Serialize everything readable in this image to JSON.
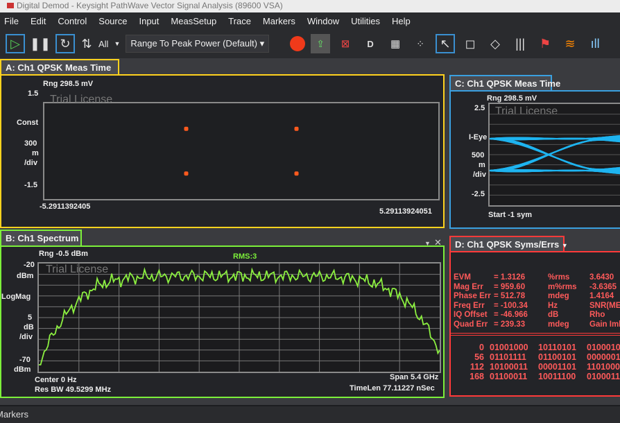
{
  "window": {
    "title": "Digital Demod - Keysight PathWave Vector Signal Analysis (89600 VSA)"
  },
  "menu": [
    "File",
    "Edit",
    "Control",
    "Source",
    "Input",
    "MeasSetup",
    "Trace",
    "Markers",
    "Window",
    "Utilities",
    "Help"
  ],
  "toolbar": {
    "all_label": "All",
    "range_mode": "Range To Peak Power (Default)"
  },
  "colors": {
    "trace_a": "#ffd21e",
    "trace_b": "#7cf03a",
    "trace_c": "#3aa0e0",
    "trace_d": "#ff3a3a",
    "spectrum": "#8cf040",
    "eye": "#1eb4f0",
    "const": "#ff5a1e"
  },
  "panel_a": {
    "tab": "A: Ch1 QPSK Meas Time",
    "range": "Rng 298.5 mV",
    "y_top": "1.5",
    "format": "Const",
    "scale": [
      "300",
      "m",
      "/div"
    ],
    "y_bottom": "-1.5",
    "x_left": "-5.2911392405",
    "x_right": "5.29113924051",
    "watermark": "Trial License",
    "points": [
      [
        -0.71,
        0.7
      ],
      [
        0.71,
        0.7
      ],
      [
        -0.71,
        -0.7
      ],
      [
        0.71,
        -0.7
      ]
    ],
    "ylim": [
      -1.5,
      1.5
    ]
  },
  "panel_c": {
    "tab": "C: Ch1 QPSK Meas Time",
    "range": "Rng 298.5 mV",
    "y_top": "2.5",
    "format": "I-Eye",
    "scale": [
      "500",
      "m",
      "/div"
    ],
    "y_bottom": "-2.5",
    "start": "Start -1  sym",
    "watermark": "Trial License"
  },
  "panel_b": {
    "tab": "B: Ch1 Spectrum",
    "range": "Rng -0.5 dBm",
    "rms": "RMS:3",
    "y_top": [
      "-20",
      "dBm"
    ],
    "format": "LogMag",
    "scale": [
      "5",
      "dB",
      "/div"
    ],
    "y_bottom": [
      "-70",
      "dBm"
    ],
    "center": "Center 0  Hz",
    "res_bw": "Res BW 49.5299 MHz",
    "span": "Span 5.4 GHz",
    "timelen": "TimeLen 77.11227 nSec",
    "watermark": "Trial License"
  },
  "panel_d": {
    "tab": "D: Ch1 QPSK Syms/Errs",
    "errors": [
      {
        "name": "EVM",
        "value": "= 1.3126",
        "unit": "%rms",
        "extra": "3.6430"
      },
      {
        "name": "Mag Err",
        "value": "= 959.60",
        "unit": "m%rms",
        "extra": "-3.6365"
      },
      {
        "name": "Phase Err",
        "value": "= 512.78",
        "unit": "mdeg",
        "extra": "1.4164"
      },
      {
        "name": "Freq Err",
        "value": "= -100.34",
        "unit": "Hz",
        "extra": "SNR(ME"
      },
      {
        "name": "IQ Offset",
        "value": "= -46.966",
        "unit": "dB",
        "extra": "Rho"
      },
      {
        "name": "Quad Err",
        "value": "= 239.33",
        "unit": "mdeg",
        "extra": "Gain Iml"
      }
    ],
    "symbols": [
      {
        "index": "0",
        "bits": [
          "01001000",
          "10110101",
          "0100010"
        ]
      },
      {
        "index": "56",
        "bits": [
          "01101111",
          "01100101",
          "0000001"
        ]
      },
      {
        "index": "112",
        "bits": [
          "10100011",
          "00001101",
          "1101000"
        ]
      },
      {
        "index": "168",
        "bits": [
          "01100011",
          "10011100",
          "0100011"
        ]
      }
    ]
  },
  "status": {
    "markers": "Markers"
  }
}
